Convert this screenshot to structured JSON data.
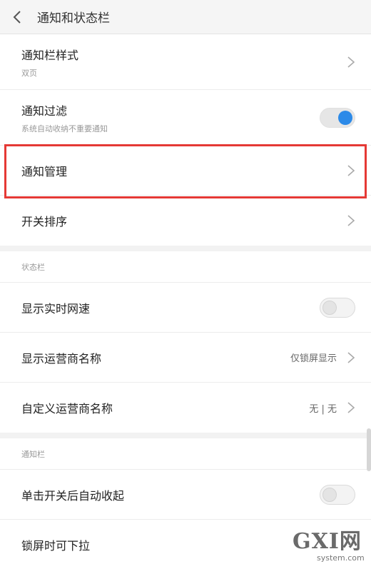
{
  "header": {
    "title": "通知和状态栏"
  },
  "notification_section": {
    "items": [
      {
        "title": "通知栏样式",
        "subtitle": "双页"
      },
      {
        "title": "通知过滤",
        "subtitle": "系统自动收纳不重要通知",
        "toggle": "on"
      },
      {
        "title": "通知管理"
      },
      {
        "title": "开关排序"
      }
    ]
  },
  "status_bar_section": {
    "header": "状态栏",
    "items": [
      {
        "title": "显示实时网速",
        "toggle": "off"
      },
      {
        "title": "显示运营商名称",
        "value": "仅锁屏显示"
      },
      {
        "title": "自定义运营商名称",
        "value": "无 | 无"
      }
    ]
  },
  "notification_bar_section": {
    "header": "通知栏",
    "items": [
      {
        "title": "单击开关后自动收起",
        "toggle": "off"
      },
      {
        "title": "锁屏时可下拉"
      }
    ]
  },
  "watermark": {
    "main": "GXI网",
    "sub": "system.com"
  },
  "colors": {
    "accent": "#2c8ae8",
    "highlight": "#e53935"
  }
}
